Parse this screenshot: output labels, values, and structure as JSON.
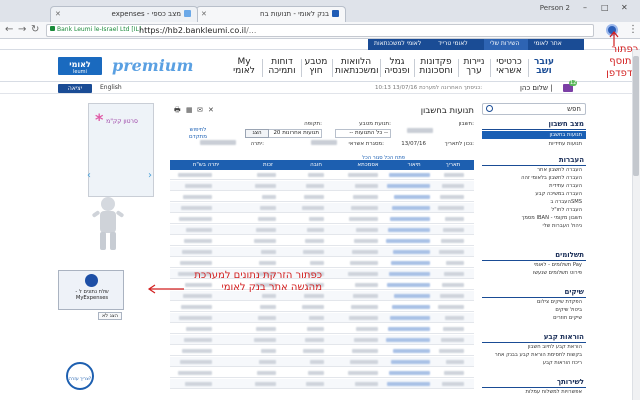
{
  "browser": {
    "tabs": [
      {
        "label": "בנק לאומי - תנועות בח"
      },
      {
        "label": "מצב כספי - expenses"
      }
    ],
    "person": "Person 2",
    "secure_label": "Bank Leumi le-Israel Ltd [IL]",
    "url_host": "https://hb2.bankleumi.co.il",
    "url_path": "/..."
  },
  "topbar": {
    "links": [
      "אתר לאומי",
      "השירות שלי",
      "לאומי טרייד",
      "לאומי למשכנתאות"
    ]
  },
  "header": {
    "logo_main": "לאומי",
    "logo_sub": "leumi",
    "brand": "premium",
    "nav": [
      "My לאומי",
      "דוחות ותמיכה",
      "מטבע חוץ",
      "הלוואות ומשכנתאות",
      "גמל ופנסיה",
      "פקדונות וחסכונות",
      "ניירות ערך",
      "כרטיסי אשראי",
      "עובר ושב"
    ]
  },
  "userrow": {
    "logout": "יציאה",
    "english": "English",
    "greeting": "שלום כהן |",
    "last_login": "10:13 13/07/16 כניסתך האחרונה למערכת:",
    "mail_badge": "12"
  },
  "sidebar": {
    "search_placeholder": "חפש",
    "sections": [
      {
        "title": "מצב חשבון",
        "items": [
          "תנועות בחשבון",
          "תנועות עתידיות"
        ]
      },
      {
        "title": "העברות",
        "items": [
          "העברה לחשבון אחר",
          "העברה לחשבון בלאומי זהה",
          "העברה עתידית",
          "העברה במשיכה קבע",
          "העברה בSMS",
          "העברה לחו\"ל",
          "מסמך IBAN - חשבון מקומי",
          "ניהול העברות שלי"
        ]
      },
      {
        "title": "תשלומים",
        "items": [
          "תשלומים - לאומי Pay",
          "פירוט תשלומים שנעשו"
        ]
      },
      {
        "title": "שיקים",
        "items": [
          "הפקדת שיקים צילום",
          "ביטול שיקים",
          "שיקים חוזרים"
        ]
      },
      {
        "title": "הוראות קבע",
        "items": [
          "הוראת קבע לחיוב חשבון",
          "בקשות לחסימת הוראת קבע בבנק אחר",
          "ריכוז הוראות קבע"
        ]
      },
      {
        "title": "לשירותך",
        "items": [
          "אפשרויות למשלוח עמלות"
        ]
      }
    ]
  },
  "main": {
    "title": "תנועות בחשבון",
    "filters": {
      "account_label": "חשבון:",
      "account_value": "",
      "type_label": "תנועת מטבע:",
      "type_value": "-- כל התנועות --",
      "period_label": "תקופה:",
      "period_value": "20 תנועות אחרונות",
      "go": "הצג",
      "advanced": "לחיפוש מתקדם"
    },
    "balance_labels": {
      "date": "נכון לתאריך:",
      "date_value": "13/07/16",
      "credit": "מסגרת אשראי:",
      "balance": "יתרה:"
    },
    "filter_links": "פתח הכל   סגור הכל",
    "table_headers": [
      "יתרה בש\"ח",
      "זכות",
      "חובה",
      "אסמכתא",
      "תיאור",
      "תאריך"
    ],
    "rows": 20
  },
  "ad": {
    "title": "סרטון קק\"מ"
  },
  "extension": {
    "button_text": "- שלח נתונים ל MyExpenses",
    "close": "הצג לא",
    "helper": "צריך עזרה?"
  },
  "annotations": {
    "top_right": [
      "כפתור",
      "התוסף",
      "לדפדפן"
    ],
    "middle": [
      "כפתור הזרקת נתונים למערכת",
      "מהגשה אתר בנק לאומי"
    ]
  },
  "colors": {
    "accent": "#1a4c95",
    "annotation": "#d21e1e",
    "table_header": "#1d5fb0"
  }
}
